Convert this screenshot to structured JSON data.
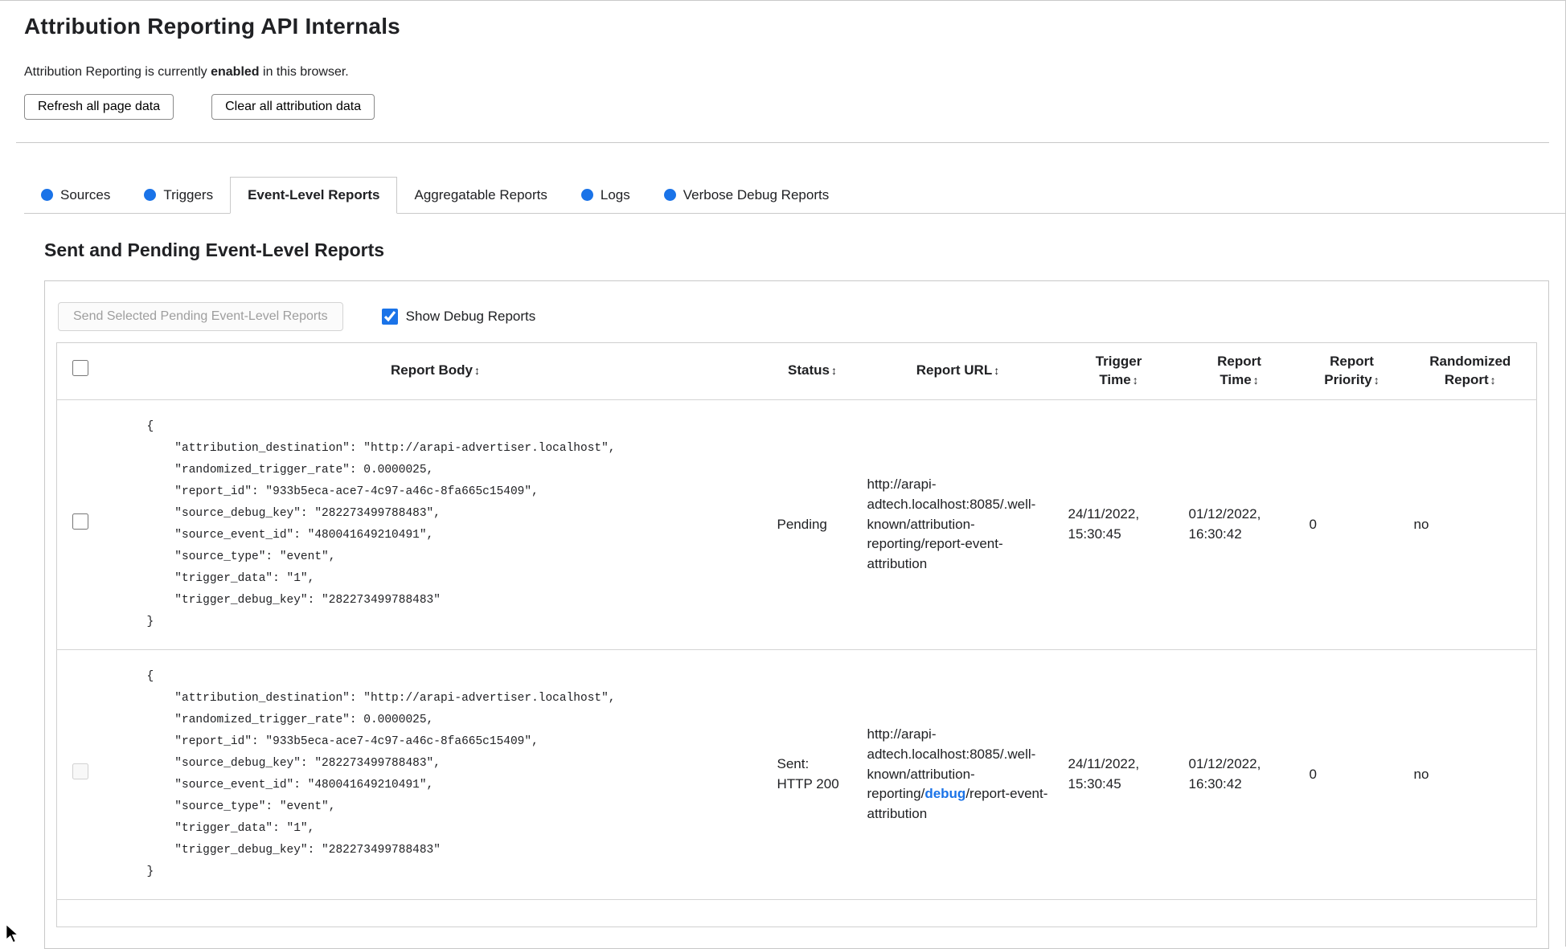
{
  "page": {
    "title": "Attribution Reporting API Internals",
    "status": {
      "prefix": "Attribution Reporting is currently ",
      "emphasis": "enabled",
      "suffix": " in this browser."
    },
    "buttons": {
      "refresh": "Refresh all page data",
      "clear": "Clear all attribution data"
    }
  },
  "tabs": {
    "dot_color": "#1a73e8",
    "items": [
      {
        "label": "Sources",
        "has_dot": true,
        "active": false
      },
      {
        "label": "Triggers",
        "has_dot": true,
        "active": false
      },
      {
        "label": "Event-Level Reports",
        "has_dot": false,
        "active": true
      },
      {
        "label": "Aggregatable Reports",
        "has_dot": false,
        "active": false
      },
      {
        "label": "Logs",
        "has_dot": true,
        "active": false
      },
      {
        "label": "Verbose Debug Reports",
        "has_dot": true,
        "active": false
      }
    ]
  },
  "section": {
    "heading": "Sent and Pending Event-Level Reports"
  },
  "controls": {
    "send_button": "Send Selected Pending Event-Level Reports",
    "send_button_disabled": true,
    "show_debug_label": "Show Debug Reports",
    "show_debug_checked": true
  },
  "table": {
    "sort_icon": "↕",
    "headers": {
      "report_body": "Report Body",
      "status": "Status",
      "report_url": "Report URL",
      "trigger_time": "Trigger Time",
      "report_time": "Report Time",
      "report_priority": "Report Priority",
      "randomized_report": "Randomized Report"
    },
    "rows": [
      {
        "selected": false,
        "checkbox_disabled": false,
        "report_body": "{\n    \"attribution_destination\": \"http://arapi-advertiser.localhost\",\n    \"randomized_trigger_rate\": 0.0000025,\n    \"report_id\": \"933b5eca-ace7-4c97-a46c-8fa665c15409\",\n    \"source_debug_key\": \"282273499788483\",\n    \"source_event_id\": \"480041649210491\",\n    \"source_type\": \"event\",\n    \"trigger_data\": \"1\",\n    \"trigger_debug_key\": \"282273499788483\"\n}",
        "status": "Pending",
        "report_url": {
          "prefix": "http://arapi-adtech.localhost:8085/.well-known/attribution-reporting/report-event-attribution",
          "debug": "",
          "suffix": ""
        },
        "trigger_time": "24/11/2022, 15:30:45",
        "report_time": "01/12/2022, 16:30:42",
        "report_priority": "0",
        "randomized_report": "no"
      },
      {
        "selected": false,
        "checkbox_disabled": true,
        "report_body": "{\n    \"attribution_destination\": \"http://arapi-advertiser.localhost\",\n    \"randomized_trigger_rate\": 0.0000025,\n    \"report_id\": \"933b5eca-ace7-4c97-a46c-8fa665c15409\",\n    \"source_debug_key\": \"282273499788483\",\n    \"source_event_id\": \"480041649210491\",\n    \"source_type\": \"event\",\n    \"trigger_data\": \"1\",\n    \"trigger_debug_key\": \"282273499788483\"\n}",
        "status": "Sent: HTTP 200",
        "report_url": {
          "prefix": "http://arapi-adtech.localhost:8085/.well-known/attribution-reporting/",
          "debug": "debug",
          "suffix": "/report-event-attribution"
        },
        "trigger_time": "24/11/2022, 15:30:45",
        "report_time": "01/12/2022, 16:30:42",
        "report_priority": "0",
        "randomized_report": "no"
      }
    ]
  }
}
